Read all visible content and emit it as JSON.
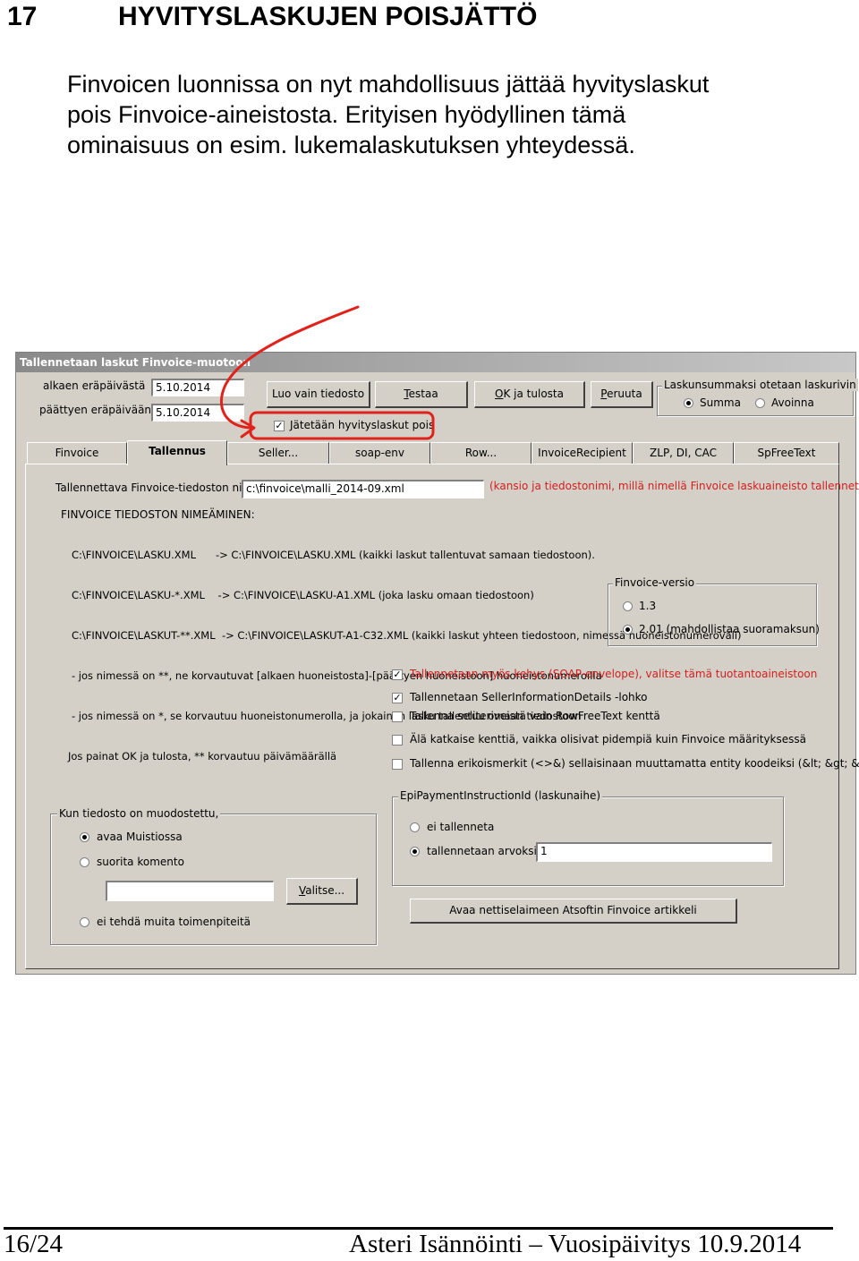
{
  "section": {
    "number": "17",
    "title": "HYVITYSLASKUJEN POISJÄTTÖ"
  },
  "intro": {
    "lines": [
      "Finvoicen luonnissa on nyt mahdollisuus jättää hyvityslaskut",
      "pois Finvoice-aineistosta. Erityisen hyödyllinen tämä",
      "ominaisuus on esim. lukemalaskutuksen yhteydessä."
    ]
  },
  "window": {
    "title": "Tallennetaan laskut Finvoice-muotoon",
    "start_due_label": "alkaen eräpäivästä",
    "start_due_value": "5.10.2014",
    "end_due_label": "päättyen eräpäivään",
    "end_due_value": "5.10.2014",
    "buttons": {
      "create_file": "Luo vain tiedosto",
      "test_prefix": "",
      "test_underlined": "T",
      "test_rest": "estaa",
      "ok_underlined": "O",
      "ok_rest": "K ja tulosta",
      "cancel_underlined": "P",
      "cancel_rest": "eruuta",
      "browse_underlined": "V",
      "browse_rest": "alitse...",
      "open_article": "Avaa nettiselaimeen Atsoftin Finvoice artikkeli"
    },
    "exclude_credit_notes_label": "Jätetään hyvityslaskut pois",
    "sum_group": {
      "title": "Laskunsummaksi otetaan laskurivin",
      "options": [
        "Summa",
        "Avoinna"
      ]
    },
    "tabs": [
      "Finvoice",
      "Tallennus",
      "Seller...",
      "soap-env",
      "Row...",
      "InvoiceRecipient",
      "ZLP, DI, CAC",
      "SpFreeText"
    ],
    "filename_label": "Tallennettava Finvoice-tiedoston nimi",
    "filename_value": "c:\\finvoice\\malli_2014-09.xml",
    "filename_hint": "(kansio ja tiedostonimi, millä nimellä Finvoice laskuaineisto tallennetaan)",
    "naming_title": "FINVOICE TIEDOSTON NIMEÄMINEN:",
    "naming_lines": [
      "C:\\FINVOICE\\LASKU.XML      -> C:\\FINVOICE\\LASKU.XML (kaikki laskut tallentuvat samaan tiedostoon).",
      "C:\\FINVOICE\\LASKU-*.XML    -> C:\\FINVOICE\\LASKU-A1.XML (joka lasku omaan tiedostoon)",
      "C:\\FINVOICE\\LASKUT-**.XML  -> C:\\FINVOICE\\LASKUT-A1-C32.XML (kaikki laskut yhteen tiedostoon, nimessä huoneistonumeroväli)",
      "- jos nimessä on **, ne korvautuvat [alkaen huoneistosta]-[päättyen huoneistoon] huoneistonumeroilla",
      "- jos nimessä on *, se korvautuu huoneistonumerolla, ja jokainen lasku tallentuu omaan tiedostoon",
      "Jos painat OK ja tulosta, ** korvautuu päivämäärällä"
    ],
    "version_group": {
      "title": "Finvoice-versio",
      "options": [
        "1.3",
        "2.01 (mahdollistaa suoramaksun)"
      ]
    },
    "checks": [
      "Tallennetaan myös kehys (SOAP-envelope), valitse tämä tuotantoaineistoon",
      "Tallennetaan SellerInformationDetails -lohko",
      "Tallenna seliteriveistä vain RowFreeText kenttä",
      "Älä katkaise kenttiä, vaikka olisivat pidempiä kuin Finvoice määrityksessä",
      "Tallenna erikoismerkit (<>&) sellaisinaan muuttamatta entity koodeiksi (&lt;  &gt;  &amp;)"
    ],
    "epi_group": {
      "title": "EpiPaymentInstructionId (laskunaihe)",
      "options": [
        "ei tallenneta",
        "tallennetaan arvoksi"
      ],
      "value": "1"
    },
    "after_group": {
      "title": "Kun tiedosto on muodostettu,",
      "options": [
        "avaa Muistiossa",
        "suorita komento",
        "ei tehdä muita toimenpiteitä"
      ],
      "command_value": ""
    }
  },
  "footer": {
    "page": "16/24",
    "publication": "Asteri Isännöinti – Vuosipäivitys 10.9.2014"
  },
  "colors": {
    "annotation_red": "#e0221c",
    "dialog_gray": "#d4d0c8",
    "hint_red": "#d21e1e"
  }
}
